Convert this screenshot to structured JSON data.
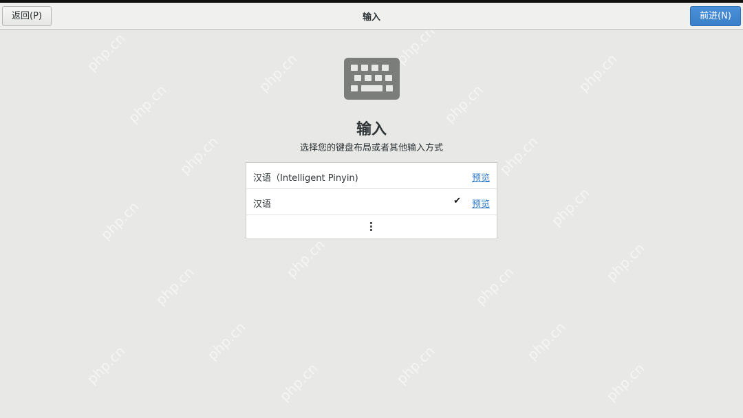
{
  "header": {
    "back_label": "返回(P)",
    "title": "输入",
    "next_label": "前进(N)"
  },
  "main": {
    "heading": "输入",
    "subtitle": "选择您的键盘布局或者其他输入方式",
    "input_sources": [
      {
        "label": "汉语（Intelligent Pinyin)",
        "preview_label": "预览",
        "selected": false
      },
      {
        "label": "汉语",
        "preview_label": "预览",
        "selected": true,
        "check": "✔"
      }
    ],
    "more_icon": "vertical-ellipsis-icon"
  },
  "watermark": "php.cn",
  "colors": {
    "next_button": "#3a80c9",
    "link": "#2a76c6",
    "background": "#e8e8e7"
  }
}
